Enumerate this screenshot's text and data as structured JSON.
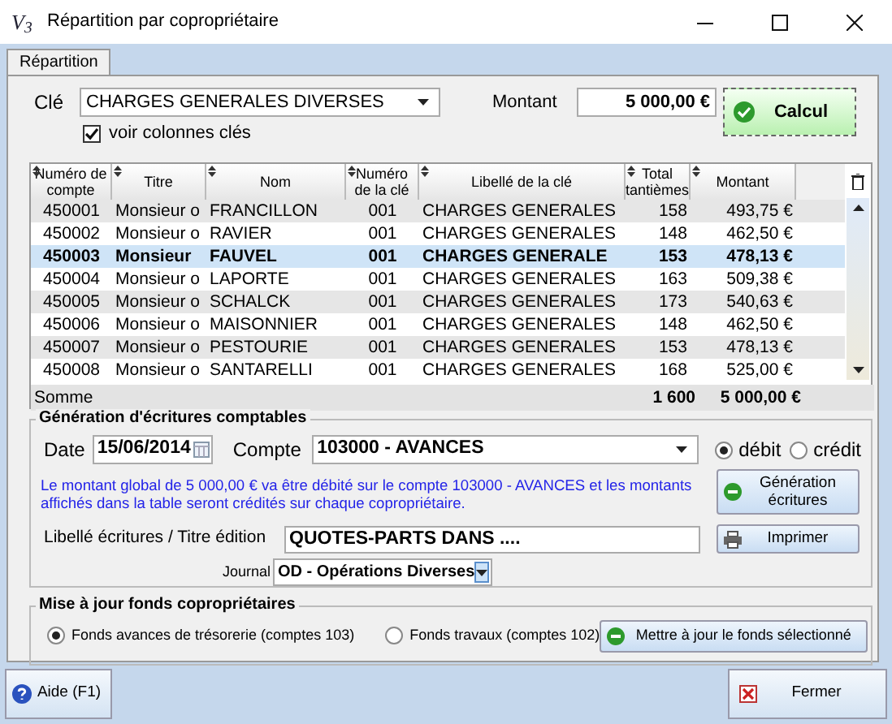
{
  "window": {
    "logo": "V$_{3}$",
    "title": "Répartition par copropriétaire"
  },
  "tabs": [
    {
      "label": "Répartition",
      "selected": true
    }
  ],
  "cle": {
    "label": "Clé",
    "value": "CHARGES GENERALES DIVERSES"
  },
  "montant": {
    "label": "Montant",
    "value": "5 000,00 €"
  },
  "calcul_button": "Calcul",
  "voir_colonnes": {
    "label": "voir colonnes clés",
    "checked": true
  },
  "table": {
    "columns": [
      "Numéro de compte",
      "Titre",
      "Nom",
      "Numéro de la clé",
      "Libellé de la clé",
      "Total tantièmes",
      "Montant"
    ],
    "rows": [
      {
        "cells": [
          "450001",
          "Monsieur o",
          "FRANCILLON",
          "001",
          "CHARGES GENERALES",
          "158",
          "493,75 €"
        ],
        "selected": false
      },
      {
        "cells": [
          "450002",
          "Monsieur o",
          "RAVIER",
          "001",
          "CHARGES GENERALES",
          "148",
          "462,50 €"
        ],
        "selected": false
      },
      {
        "cells": [
          "450003",
          "Monsieur",
          "FAUVEL",
          "001",
          "CHARGES GENERALE",
          "153",
          "478,13 €"
        ],
        "selected": true
      },
      {
        "cells": [
          "450004",
          "Monsieur o",
          "LAPORTE",
          "001",
          "CHARGES GENERALES",
          "163",
          "509,38 €"
        ],
        "selected": false
      },
      {
        "cells": [
          "450005",
          "Monsieur o",
          "SCHALCK",
          "001",
          "CHARGES GENERALES",
          "173",
          "540,63 €"
        ],
        "selected": false
      },
      {
        "cells": [
          "450006",
          "Monsieur o",
          "MAISONNIER",
          "001",
          "CHARGES GENERALES",
          "148",
          "462,50 €"
        ],
        "selected": false
      },
      {
        "cells": [
          "450007",
          "Monsieur o",
          "PESTOURIE",
          "001",
          "CHARGES GENERALES",
          "153",
          "478,13 €"
        ],
        "selected": false
      },
      {
        "cells": [
          "450008",
          "Monsieur o",
          "SANTARELLI",
          "001",
          "CHARGES GENERALES",
          "168",
          "525,00 €"
        ],
        "selected": false
      }
    ],
    "sum": {
      "label": "Somme",
      "total": "1 600",
      "montant": "5 000,00 €"
    }
  },
  "generation": {
    "title": "Génération d'écritures comptables",
    "date_label": "Date",
    "date": "15/06/2014",
    "compte_label": "Compte",
    "compte": "103000 - AVANCES",
    "sens": [
      {
        "label": "débit",
        "selected": true
      },
      {
        "label": "crédit",
        "selected": false
      }
    ],
    "message": "Le montant global de 5 000,00 € va être débité sur le compte 103000 - AVANCES et les montants affichés dans la table seront crédités sur chaque copropriétaire.",
    "generation_button": "Génération écritures",
    "libelle_label": "Libellé écritures / Titre édition",
    "libelle": "QUOTES-PARTS DANS ....",
    "print_button": "Imprimer",
    "journal_label": "Journal",
    "journal": "OD - Opérations Diverses"
  },
  "fonds": {
    "title": "Mise à jour fonds copropriétaires",
    "options": [
      {
        "label": "Fonds avances de trésorerie (comptes 103)",
        "selected": true
      },
      {
        "label": "Fonds travaux (comptes 102)",
        "selected": false
      }
    ],
    "button": "Mettre à jour le fonds sélectionné"
  },
  "footer": {
    "help_button": "Aide (F1)",
    "close_button": "Fermer"
  }
}
